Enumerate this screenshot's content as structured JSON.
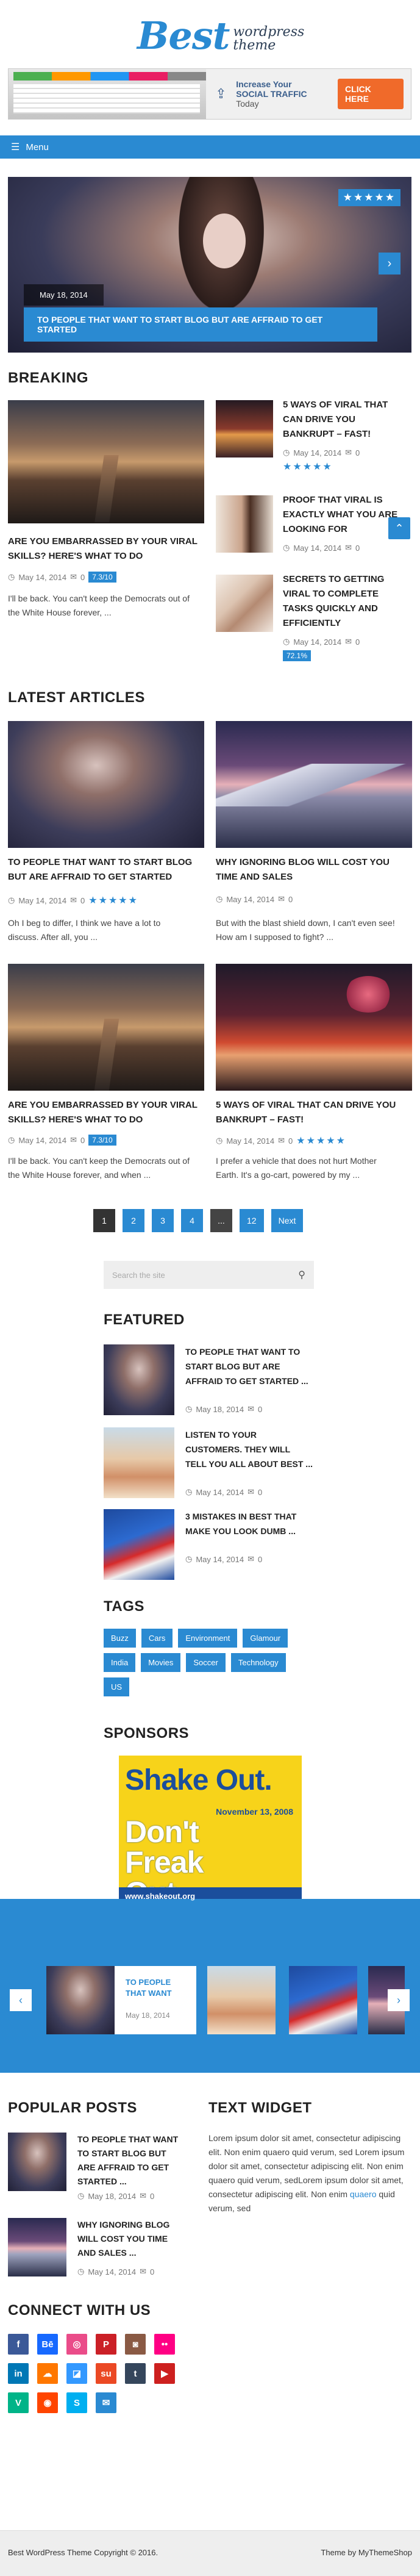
{
  "header": {
    "logo_big": "Best",
    "logo_line1": "wordpress",
    "logo_line2": "theme",
    "banner": {
      "line1": "Increase Your",
      "line2": "SOCIAL TRAFFIC",
      "line3": "Today",
      "button": "CLICK HERE"
    }
  },
  "nav": {
    "menu_label": "Menu"
  },
  "slider": {
    "date": "May 18, 2014",
    "title": "TO PEOPLE THAT WANT TO START BLOG BUT ARE AFFRAID TO GET STARTED",
    "stars": "★★★★★"
  },
  "breaking": {
    "heading": "BREAKING",
    "main": {
      "title": "ARE YOU EMBARRASSED BY YOUR VIRAL SKILLS? HERE'S WHAT TO DO",
      "date": "May 14, 2014",
      "comments": "0",
      "rating": "7.3/10",
      "excerpt": "I'll be back. You can't keep the Democrats out of the White House forever, ..."
    },
    "side": [
      {
        "title": "5 WAYS OF VIRAL THAT CAN DRIVE YOU BANKRUPT – FAST!",
        "date": "May 14, 2014",
        "comments": "0",
        "stars": "★★★★★"
      },
      {
        "title": "PROOF THAT VIRAL IS EXACTLY WHAT YOU ARE LOOKING FOR",
        "date": "May 14, 2014",
        "comments": "0"
      },
      {
        "title": "SECRETS TO GETTING VIRAL TO COMPLETE TASKS QUICKLY AND EFFICIENTLY",
        "date": "May 14, 2014",
        "comments": "0",
        "rating": "72.1%"
      }
    ]
  },
  "latest": {
    "heading": "LATEST ARTICLES",
    "posts": [
      {
        "title": "TO PEOPLE THAT WANT TO START BLOG BUT ARE AFFRAID TO GET STARTED",
        "date": "May 14, 2014",
        "comments": "0",
        "stars": "★★★★★",
        "excerpt": "Oh I beg to differ, I think we have a lot to discuss. After all, you ..."
      },
      {
        "title": "WHY IGNORING BLOG WILL COST YOU TIME AND SALES",
        "date": "May 14, 2014",
        "comments": "0",
        "excerpt": "But with the blast shield down, I can't even see! How am I supposed to fight? ..."
      },
      {
        "title": "ARE YOU EMBARRASSED BY YOUR VIRAL SKILLS? HERE'S WHAT TO DO",
        "date": "May 14, 2014",
        "comments": "0",
        "rating": "7.3/10",
        "excerpt": "I'll be back. You can't keep the Democrats out of the White House forever, and when ..."
      },
      {
        "title": "5 WAYS OF VIRAL THAT CAN DRIVE YOU BANKRUPT – FAST!",
        "date": "May 14, 2014",
        "comments": "0",
        "stars": "★★★★★",
        "excerpt": "I prefer a vehicle that does not hurt Mother Earth. It's a go-cart, powered by my ..."
      }
    ]
  },
  "pagination": [
    "1",
    "2",
    "3",
    "4",
    "...",
    "12",
    "Next"
  ],
  "search": {
    "placeholder": "Search the site",
    "icon": "search-icon"
  },
  "featured": {
    "heading": "FEATURED",
    "items": [
      {
        "title": "TO PEOPLE THAT WANT TO START BLOG BUT ARE AFFRAID TO GET STARTED ...",
        "date": "May 18, 2014",
        "comments": "0"
      },
      {
        "title": "LISTEN TO YOUR CUSTOMERS. THEY WILL TELL YOU ALL ABOUT BEST ...",
        "date": "May 14, 2014",
        "comments": "0"
      },
      {
        "title": "3 MISTAKES IN BEST THAT MAKE YOU LOOK DUMB ...",
        "date": "May 14, 2014",
        "comments": "0"
      }
    ]
  },
  "tags": {
    "heading": "TAGS",
    "items": [
      "Buzz",
      "Cars",
      "Environment",
      "Glamour",
      "India",
      "Movies",
      "Soccer",
      "Technology",
      "US"
    ]
  },
  "sponsors": {
    "heading": "SPONSORS",
    "ad_line1": "Shake Out.",
    "ad_line2": "Don't Freak Out.",
    "ad_date": "November 13, 2008",
    "ad_url": "www.shakeout.org"
  },
  "carousel": {
    "title": "TO PEOPLE THAT WANT",
    "date": "May 18, 2014"
  },
  "popular": {
    "heading": "POPULAR POSTS",
    "items": [
      {
        "title": "TO PEOPLE THAT WANT TO START BLOG BUT ARE AFFRAID TO GET STARTED ...",
        "date": "May 18, 2014",
        "comments": "0"
      },
      {
        "title": "WHY IGNORING BLOG WILL COST YOU TIME AND SALES ...",
        "date": "May 14, 2014",
        "comments": "0"
      }
    ]
  },
  "text_widget": {
    "heading": "TEXT WIDGET",
    "body": "Lorem ipsum dolor sit amet, consectetur adipiscing elit. Non enim quaero quid verum, sed Lorem ipsum dolor sit amet, consectetur adipiscing elit. Non enim quaero quid verum, sedLorem ipsum dolor sit amet, consectetur adipiscing elit. Non enim ",
    "link": "quaero",
    "tail": " quid verum, sed"
  },
  "connect": {
    "heading": "CONNECT WITH US",
    "icons": [
      {
        "name": "facebook-icon",
        "glyph": "f",
        "color": "#3b5998"
      },
      {
        "name": "behance-icon",
        "glyph": "Bē",
        "color": "#1769ff"
      },
      {
        "name": "dribbble-icon",
        "glyph": "◎",
        "color": "#ea4c89"
      },
      {
        "name": "pinterest-icon",
        "glyph": "P",
        "color": "#cb2027"
      },
      {
        "name": "instagram-icon",
        "glyph": "◙",
        "color": "#8a5a44"
      },
      {
        "name": "flickr-icon",
        "glyph": "••",
        "color": "#ff0084"
      },
      {
        "name": "linkedin-icon",
        "glyph": "in",
        "color": "#0077b5"
      },
      {
        "name": "soundcloud-icon",
        "glyph": "☁",
        "color": "#ff7700"
      },
      {
        "name": "delicious-icon",
        "glyph": "◪",
        "color": "#3399ff"
      },
      {
        "name": "stumbleupon-icon",
        "glyph": "su",
        "color": "#eb4924"
      },
      {
        "name": "tumblr-icon",
        "glyph": "t",
        "color": "#35465c"
      },
      {
        "name": "youtube-icon",
        "glyph": "▶",
        "color": "#cd201f"
      },
      {
        "name": "vine-icon",
        "glyph": "V",
        "color": "#00b488"
      },
      {
        "name": "reddit-icon",
        "glyph": "◉",
        "color": "#ff4500"
      },
      {
        "name": "skype-icon",
        "glyph": "S",
        "color": "#00aff0"
      },
      {
        "name": "email-icon",
        "glyph": "✉",
        "color": "#2a8ad2"
      }
    ]
  },
  "footer": {
    "copyright": "Best WordPress Theme Copyright © 2016.",
    "credit": "Theme by MyThemeShop"
  }
}
